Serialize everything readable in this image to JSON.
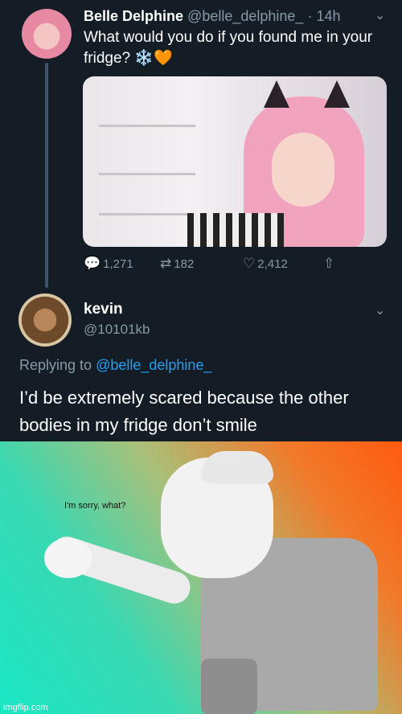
{
  "tweet": {
    "name": "Belle Delphine",
    "handle": "@belle_delphine_",
    "separator": "·",
    "time": "14h",
    "text": "What would you do if you found me in your fridge? ❄️🧡",
    "actions": {
      "reply_count": "1,271",
      "retweet_count": "182",
      "like_count": "2,412"
    }
  },
  "reply": {
    "name": "kevin",
    "handle": "@10101kb",
    "replying_prefix": "Replying to",
    "replying_handle": "@belle_delphine_",
    "text": "I’d be extremely scared because the other bodies in my fridge don’t smile"
  },
  "meme": {
    "caption": "I'm sorry, what?",
    "watermark": "imgflip.com"
  },
  "icons": [
    "chevron-down-icon",
    "reply-icon",
    "retweet-icon",
    "like-icon",
    "share-icon"
  ],
  "colors": {
    "background": "#141d26",
    "muted": "#8899a6",
    "link": "#1da1f2"
  }
}
